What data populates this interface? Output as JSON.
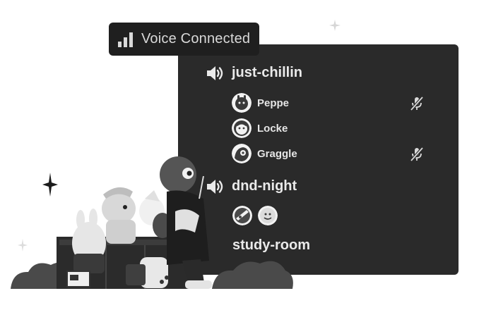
{
  "badge": {
    "label": "Voice Connected",
    "icon": "signal-bars-icon"
  },
  "channels": [
    {
      "name": "just-chillin",
      "icon": "speaker-icon",
      "members": [
        {
          "name": "Peppe",
          "muted": true
        },
        {
          "name": "Locke",
          "muted": false
        },
        {
          "name": "Graggle",
          "muted": true
        }
      ]
    },
    {
      "name": "dnd-night",
      "icon": "speaker-icon"
    },
    {
      "name": "study-room"
    }
  ],
  "colors": {
    "panel": "#2a2a2a",
    "badge": "#1f1f1f",
    "text": "#eaeaea"
  }
}
